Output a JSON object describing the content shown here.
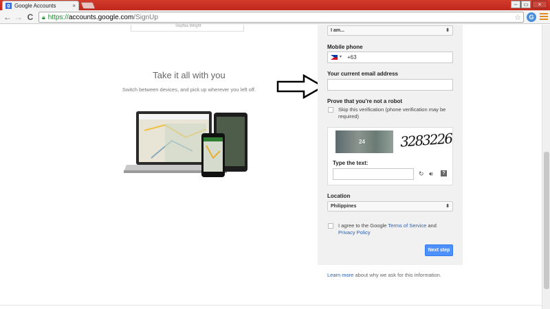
{
  "browser": {
    "tab_title": "Google Accounts",
    "tab_close": "×",
    "url_scheme": "https://",
    "url_host": "accounts.google.com",
    "url_path": "/SignUp",
    "nav_back": "←",
    "nav_forward": "→",
    "nav_reload": "C",
    "star": "☆",
    "window_min": "–",
    "window_max": "▭",
    "window_close": "×",
    "extension_letter": "G"
  },
  "promo": {
    "people": [
      "Sophia Wright"
    ],
    "title": "Take it all with you",
    "subtitle": "Switch between devices, and pick up wherever you left off."
  },
  "form": {
    "gender_select": "I am...",
    "mobile_label": "Mobile phone",
    "phone_code": "+63",
    "email_label": "Your current email address",
    "email_value": "",
    "robot_label": "Prove that you're not a robot",
    "skip_label": "Skip this verification (phone verification may be required)",
    "captcha_text": "3283226",
    "captcha_small": "24",
    "type_text_label": "Type the text:",
    "location_label": "Location",
    "location_value": "Philippines",
    "agree_prefix": "I agree to the Google ",
    "terms_link": "Terms of Service",
    "agree_and": " and",
    "privacy_link": "Privacy Policy",
    "next_button": "Next step",
    "learn_more_link": "Learn more",
    "learn_more_rest": " about why we ask for this information."
  },
  "colors": {
    "titlebar": "#c0281c",
    "accent_button": "#4d90fe",
    "link": "#2a5db0"
  }
}
